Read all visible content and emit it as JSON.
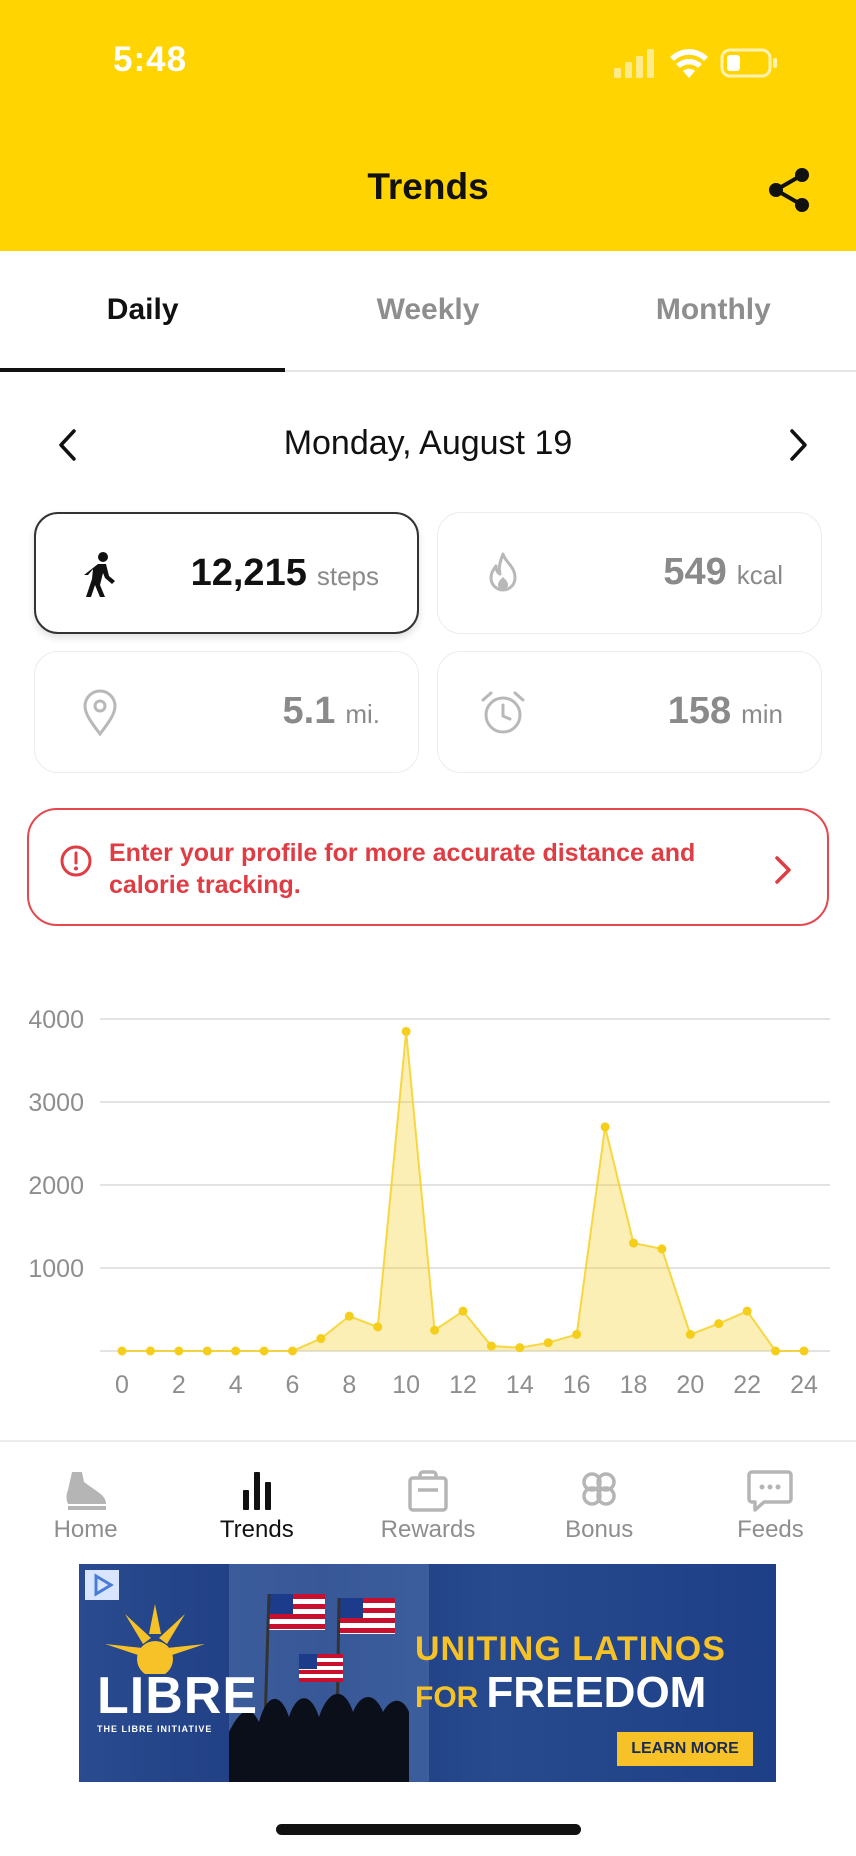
{
  "status_bar": {
    "time": "5:48"
  },
  "header": {
    "title": "Trends"
  },
  "tabs": [
    {
      "label": "Daily",
      "active": true
    },
    {
      "label": "Weekly",
      "active": false
    },
    {
      "label": "Monthly",
      "active": false
    }
  ],
  "date_nav": {
    "date": "Monday, August 19"
  },
  "stats": {
    "steps": {
      "value": "12,215",
      "unit": "steps",
      "icon": "walking-person-icon"
    },
    "calories": {
      "value": "549",
      "unit": "kcal",
      "icon": "flame-icon"
    },
    "distance": {
      "value": "5.1",
      "unit": "mi.",
      "icon": "location-pin-icon"
    },
    "time": {
      "value": "158",
      "unit": "min",
      "icon": "alarm-clock-icon"
    }
  },
  "alert": {
    "text": "Enter your profile for more accurate distance and calorie tracking."
  },
  "chart_data": {
    "type": "area",
    "x": [
      0,
      1,
      2,
      3,
      4,
      5,
      6,
      7,
      8,
      9,
      10,
      11,
      12,
      13,
      14,
      15,
      16,
      17,
      18,
      19,
      20,
      21,
      22,
      23,
      24
    ],
    "values": [
      0,
      0,
      0,
      0,
      0,
      0,
      0,
      150,
      420,
      290,
      3850,
      250,
      480,
      60,
      40,
      100,
      200,
      2700,
      1300,
      1230,
      200,
      330,
      480,
      0,
      0
    ],
    "x_ticks": [
      "0",
      "2",
      "4",
      "6",
      "8",
      "10",
      "12",
      "14",
      "16",
      "18",
      "20",
      "22",
      "24"
    ],
    "y_ticks": [
      "1000",
      "2000",
      "3000",
      "4000"
    ],
    "ylim": [
      0,
      4000
    ],
    "grid": true,
    "color": "#F5CE1B"
  },
  "bottom_nav": [
    {
      "label": "Home",
      "icon": "shoe-icon",
      "active": false
    },
    {
      "label": "Trends",
      "icon": "bar-chart-icon",
      "active": true
    },
    {
      "label": "Rewards",
      "icon": "shopping-bag-icon",
      "active": false
    },
    {
      "label": "Bonus",
      "icon": "clover-icon",
      "active": false
    },
    {
      "label": "Feeds",
      "icon": "chat-bubble-icon",
      "active": false
    }
  ],
  "ad": {
    "brand": "LIBRE",
    "brand_sub": "THE LIBRE INITIATIVE",
    "headline_line1": "UNITING LATINOS",
    "headline_for": "FOR",
    "headline_line2": "FREEDOM",
    "cta": "LEARN MORE"
  },
  "colors": {
    "header_bg": "#FFD400",
    "alert": "#E5484D",
    "chart": "#F5CE1B"
  }
}
